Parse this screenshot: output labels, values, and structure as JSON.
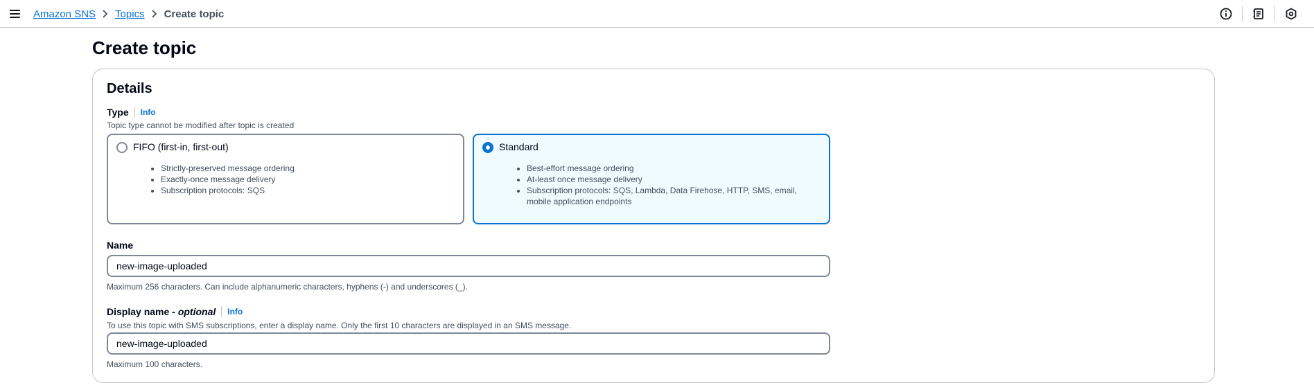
{
  "topbar": {
    "menu_icon": "hamburger-menu-icon",
    "breadcrumb": [
      {
        "label": "Amazon SNS",
        "link": true
      },
      {
        "label": "Topics",
        "link": true
      },
      {
        "label": "Create topic",
        "link": false
      }
    ],
    "icons": [
      "info-icon",
      "notes-icon",
      "settings-shield-icon"
    ]
  },
  "page": {
    "title": "Create topic"
  },
  "details": {
    "title": "Details",
    "type": {
      "label": "Type",
      "info": "Info",
      "description": "Topic type cannot be modified after topic is created",
      "options": [
        {
          "title": "FIFO (first-in, first-out)",
          "selected": false,
          "bullets": [
            "Strictly-preserved message ordering",
            "Exactly-once message delivery",
            "Subscription protocols: SQS"
          ]
        },
        {
          "title": "Standard",
          "selected": true,
          "bullets": [
            "Best-effort message ordering",
            "At-least once message delivery",
            "Subscription protocols: SQS, Lambda, Data Firehose, HTTP, SMS, email, mobile application endpoints"
          ]
        }
      ]
    },
    "name": {
      "label": "Name",
      "value": "new-image-uploaded",
      "constraint": "Maximum 256 characters. Can include alphanumeric characters, hyphens (-) and underscores (_)."
    },
    "display_name": {
      "label": "Display name - ",
      "optional": "optional",
      "info": "Info",
      "description": "To use this topic with SMS subscriptions, enter a display name. Only the first 10 characters are displayed in an SMS message.",
      "value": "new-image-uploaded",
      "constraint": "Maximum 100 characters."
    }
  },
  "colors": {
    "link": "#0972d3",
    "selected_border": "#0972d3",
    "selected_bg": "#f0fbff",
    "border": "#7d8998",
    "text_secondary": "#414d5c"
  }
}
